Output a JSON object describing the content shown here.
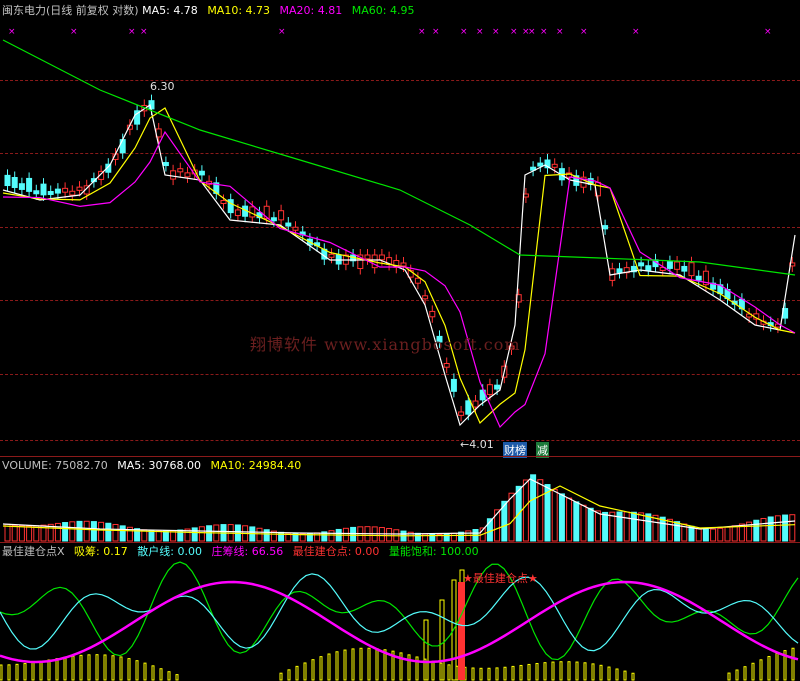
{
  "price": {
    "name": "闽东电力",
    "period": "(日线 前复权 对数)",
    "ma5_label": "MA5:",
    "ma5": "4.78",
    "ma10_label": "MA10:",
    "ma10": "4.73",
    "ma20_label": "MA20:",
    "ma20": "4.81",
    "ma60_label": "MA60:",
    "ma60": "4.95",
    "high_marker": "6.30",
    "low_marker": "←4.01",
    "tag_finance": "财榜",
    "tag_reduce": "减",
    "watermark": "翔博软件 www.xiangbosoft.com"
  },
  "volume": {
    "label": "VOLUME:",
    "value": "75082.70",
    "ma5_label": "MA5:",
    "ma5": "30768.00",
    "ma10_label": "MA10:",
    "ma10": "24984.40"
  },
  "indicator": {
    "name": "最佳建仓点X",
    "absorb_label": "吸筹:",
    "absorb": "0.17",
    "retail_label": "散户线:",
    "retail": "0.00",
    "dealer_label": "庄筹线:",
    "dealer": "66.56",
    "best_label": "最佳建仓点:",
    "best": "0.00",
    "energy_label": "量能饱和:",
    "energy": "100.00",
    "signal_text": "★最佳建仓点★"
  },
  "colors": {
    "up": "#ff3232",
    "down": "#54fcfc",
    "ma5": "#ffffff",
    "ma10": "#ffff00",
    "ma20": "#ff00ff",
    "ma60": "#00e600",
    "grid": "#8b1a1a"
  },
  "icons": {
    "event_marker": "x-mark-icon"
  }
}
